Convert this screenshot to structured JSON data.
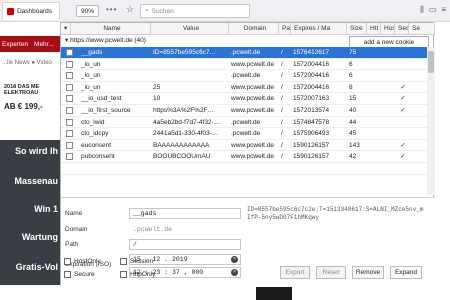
{
  "browser": {
    "tab_label": "Dashboards",
    "zoom": "90%",
    "dots": "•••",
    "search_placeholder": "Suchen",
    "accent": "#2a73d8"
  },
  "site": {
    "nav_items": [
      "Experten",
      "Mehr..."
    ],
    "sub": "...lle News  ● Video",
    "ad_title_1": "2018 DAS ME",
    "ad_title_2": "ELEKTROAU",
    "ad_price": "AB € 199,-",
    "dark_items": [
      "So wird Ih",
      "Massenau",
      "Win 1",
      "Wartung",
      "Gratis-Vol"
    ]
  },
  "table": {
    "columns": [
      "Name",
      "Value",
      "Domain",
      "Pa",
      "Expires / Ma",
      "Size",
      "Htt",
      "Hos",
      "Sec",
      "Se"
    ],
    "group": "https://www.pcwelt.de (40)",
    "add_cookie_label": "add a new cookie",
    "rows": [
      {
        "name": "__gads",
        "value": "ID=8557be595c6c7…",
        "domain": ".pcwelt.de",
        "path": "/",
        "expires": "1576412617",
        "size": "75",
        "hos": "",
        "sec": "",
        "selected": true
      },
      {
        "name": "_io_un",
        "value": "",
        "domain": "www.pcwelt.de",
        "path": "/",
        "expires": "1572004416",
        "size": "6",
        "hos": "",
        "sec": "",
        "selected": false
      },
      {
        "name": "_io_un",
        "value": "",
        "domain": ".pcwelt.de",
        "path": "/",
        "expires": "1572004416",
        "size": "6",
        "hos": "",
        "sec": "",
        "selected": false
      },
      {
        "name": "_io_un",
        "value": "25",
        "domain": "www.pcwelt.de",
        "path": "/",
        "expires": "1572004416",
        "size": "8",
        "hos": "",
        "sec": "✓",
        "selected": false
      },
      {
        "name": "__io_usd_test",
        "value": "10",
        "domain": "www.pcwelt.de",
        "path": "/",
        "expires": "1572007163",
        "size": "15",
        "hos": "",
        "sec": "✓",
        "selected": false
      },
      {
        "name": "__io_first_source",
        "value": "https%3A%2F%2F…",
        "domain": "www.pcwelt.de",
        "path": "/",
        "expires": "1572013574",
        "size": "40",
        "hos": "",
        "sec": "✓",
        "selected": false
      },
      {
        "name": "cto_lwid",
        "value": "4a5eb2bd-f7d7-4f32-…",
        "domain": ".pcwelt.de",
        "path": "/",
        "expires": "1574847578",
        "size": "44",
        "hos": "",
        "sec": "",
        "selected": false
      },
      {
        "name": "cto_idcpy",
        "value": "2441a5d1-330-4f03-…",
        "domain": ".pcwelt.de",
        "path": "/",
        "expires": "1575906493",
        "size": "45",
        "hos": "",
        "sec": "",
        "selected": false
      },
      {
        "name": "euconsent",
        "value": "BAAAAAAAAAAAA",
        "domain": "www.pcwelt.de",
        "path": "/",
        "expires": "1590126157",
        "size": "143",
        "hos": "",
        "sec": "✓",
        "selected": false
      },
      {
        "name": "pubconsent",
        "value": "BOOUBCOOUmAU",
        "domain": "www.pcwelt.de",
        "path": "/",
        "expires": "1590126157",
        "size": "42",
        "hos": "",
        "sec": "✓",
        "selected": false
      },
      {
        "name": "",
        "value": "",
        "domain": "",
        "path": "",
        "expires": "",
        "size": "",
        "hos": "",
        "sec": "",
        "selected": false
      }
    ]
  },
  "editor": {
    "name_label": "Name",
    "name_value": "__gads",
    "domain_label": "Domain",
    "domain_value": ".pcwelt.de",
    "path_label": "Path",
    "path_value": "/",
    "expiration_label": "Expiration (ISO)",
    "date_value": "15 . 12 . 2019",
    "time_value": "12 : 23 : 37 , 000",
    "raw_value": "ID=8557be595c6c7c2e:T=1513340617:S=ALNI_MZce5nv_mIfP-5ny5wD07F1hMKqwy",
    "hostonly_label": "HostOnly",
    "session_label": "Session",
    "secure_label": "Secure",
    "httponly_label": "HttpOnly",
    "buttons": [
      "Export",
      "Reset",
      "Remove",
      "Expand"
    ]
  }
}
